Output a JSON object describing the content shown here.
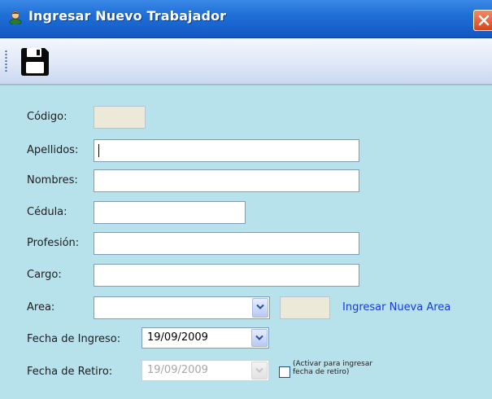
{
  "window": {
    "title": "Ingresar Nuevo Trabajador",
    "title_icon": "user-icon",
    "close_icon": "close-icon"
  },
  "toolbar": {
    "save_icon": "floppy-disk-icon"
  },
  "form": {
    "codigo": {
      "label": "Código:",
      "value": "",
      "enabled": false
    },
    "apellidos": {
      "label": "Apellidos:",
      "value": ""
    },
    "nombres": {
      "label": "Nombres:",
      "value": ""
    },
    "cedula": {
      "label": "Cédula:",
      "value": ""
    },
    "profesion": {
      "label": "Profesión:",
      "value": ""
    },
    "cargo": {
      "label": "Cargo:",
      "value": ""
    },
    "area": {
      "label": "Area:",
      "value": "",
      "code_value": "",
      "new_area_link": "Ingresar Nueva Area"
    },
    "fecha_ingreso": {
      "label": "Fecha de Ingreso:",
      "value": "19/09/2009"
    },
    "fecha_retiro": {
      "label": "Fecha de Retiro:",
      "value": "19/09/2009",
      "enabled": false,
      "checkbox_checked": false,
      "checkbox_note_line1": "(Activar para ingresar",
      "checkbox_note_line2": "fecha de retiro)"
    }
  },
  "colors": {
    "titlebar": "#1f6fd7",
    "form_background": "#b7e1eb",
    "link": "#1a3cd6",
    "disabled_field": "#ece9d8"
  }
}
